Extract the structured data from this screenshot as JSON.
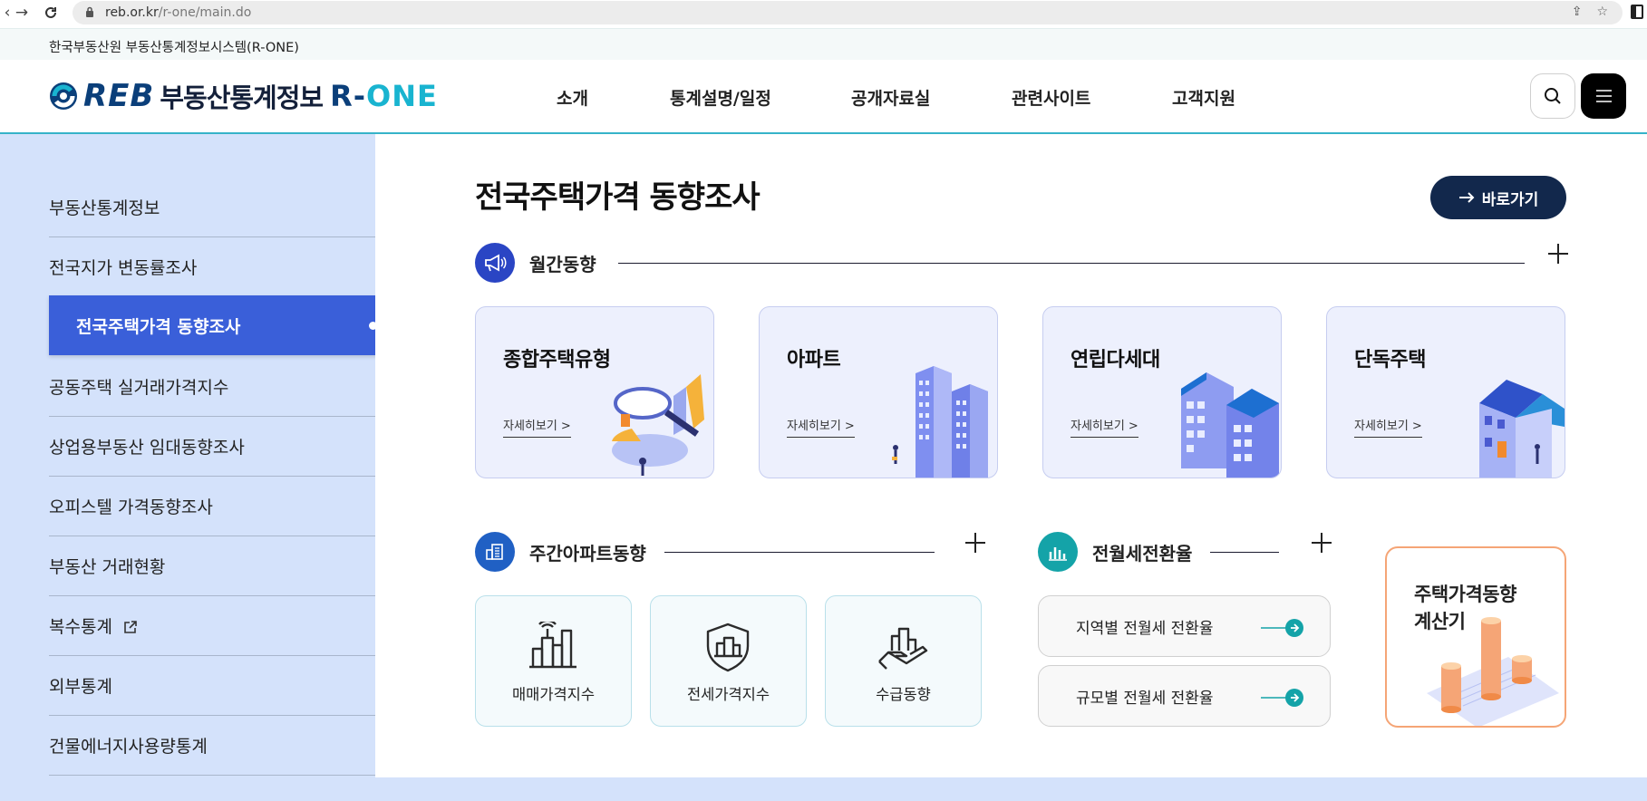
{
  "browser": {
    "url_host": "reb.or.kr",
    "url_path": "/r-one/main.do"
  },
  "site": {
    "name": "한국부동산원 부동산통계정보시스템(R-ONE)",
    "logo_reb": "REB",
    "logo_korean": "부동산통계정보",
    "logo_r": "R-",
    "logo_one": "ONE"
  },
  "gnb": [
    {
      "label": "소개"
    },
    {
      "label": "통계설명/일정"
    },
    {
      "label": "공개자료실"
    },
    {
      "label": "관련사이트"
    },
    {
      "label": "고객지원"
    }
  ],
  "sidebar": {
    "items": [
      {
        "label": "부동산통계정보"
      },
      {
        "label": "전국지가 변동률조사"
      },
      {
        "label": "전국주택가격 동향조사",
        "active": true
      },
      {
        "label": "공동주택 실거래가격지수"
      },
      {
        "label": "상업용부동산 임대동향조사"
      },
      {
        "label": "오피스텔 가격동향조사"
      },
      {
        "label": "부동산 거래현황"
      },
      {
        "label": "복수통계",
        "external": true
      },
      {
        "label": "외부통계"
      },
      {
        "label": "건물에너지사용량통계"
      }
    ]
  },
  "main": {
    "title": "전국주택가격 동향조사",
    "shortcut_label": "바로가기",
    "monthly": {
      "title": "월간동향",
      "cards": [
        {
          "title": "종합주택유형",
          "more": "자세히보기 >"
        },
        {
          "title": "아파트",
          "more": "자세히보기 >"
        },
        {
          "title": "연립다세대",
          "more": "자세히보기 >"
        },
        {
          "title": "단독주택",
          "more": "자세히보기 >"
        }
      ]
    },
    "weekly": {
      "title": "주간아파트동향",
      "cards": [
        {
          "label": "매매가격지수"
        },
        {
          "label": "전세가격지수"
        },
        {
          "label": "수급동향"
        }
      ]
    },
    "rent": {
      "title": "전월세전환율",
      "buttons": [
        {
          "label": "지역별 전월세 전환율"
        },
        {
          "label": "규모별 전월세 전환율"
        }
      ]
    },
    "calculator": {
      "line1": "주택가격동향",
      "line2": "계산기"
    }
  },
  "colors": {
    "brand_navy": "#12284c",
    "accent_blue": "#3a5fd9",
    "teal": "#14a3a8",
    "sidebar_bg": "#d4e2fb",
    "calc_border": "#f5a576"
  }
}
